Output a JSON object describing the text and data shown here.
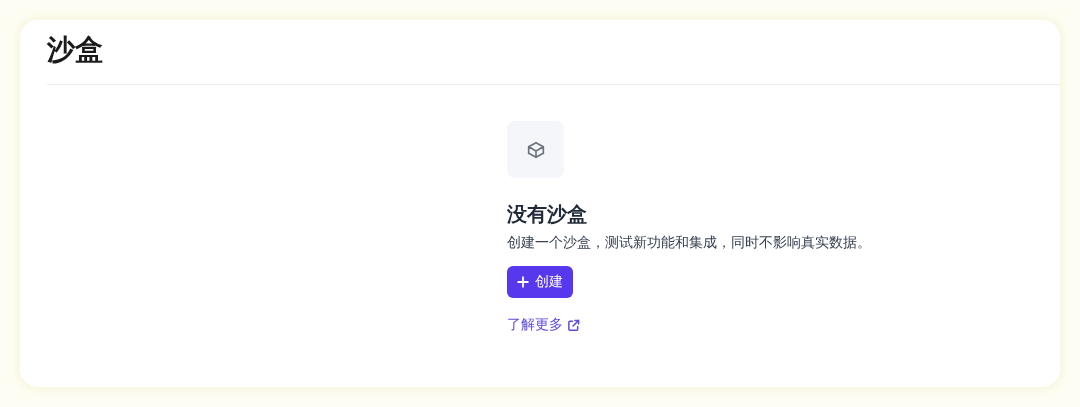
{
  "page": {
    "title": "沙盒"
  },
  "empty_state": {
    "heading": "没有沙盒",
    "description": "创建一个沙盒，测试新功能和集成，同时不影响真实数据。",
    "button": {
      "label": "创建"
    },
    "link": {
      "label": "了解更多"
    }
  }
}
